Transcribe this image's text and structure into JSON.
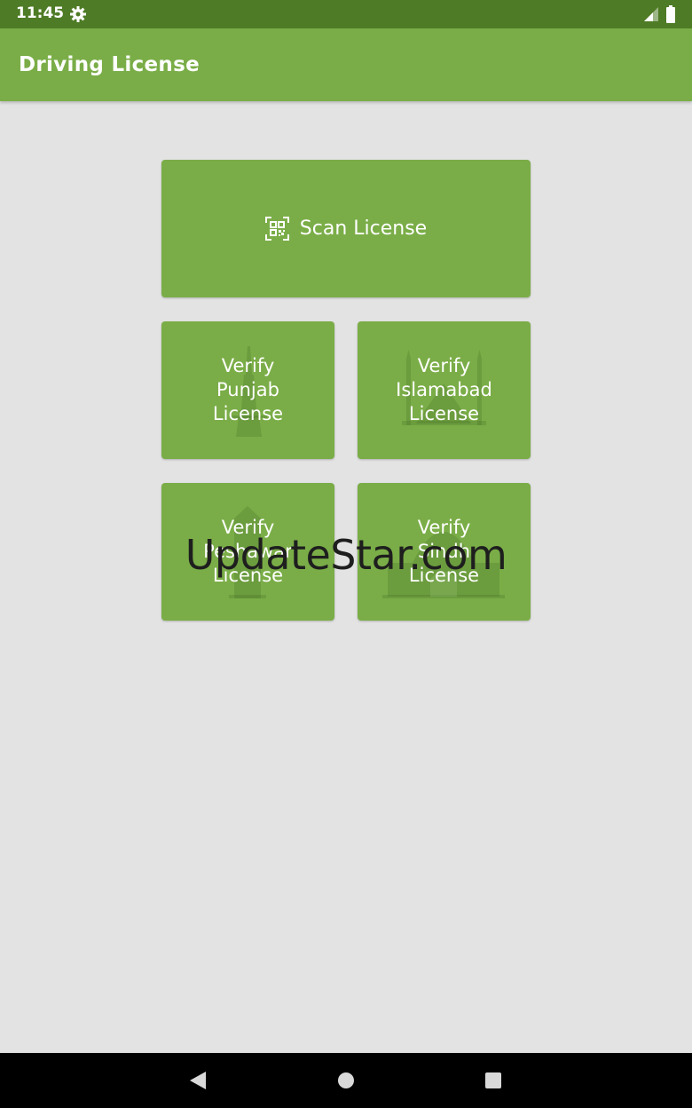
{
  "status_bar": {
    "time": "11:45",
    "icons": [
      "gear-icon",
      "signal-icon",
      "battery-icon"
    ]
  },
  "app_bar": {
    "title": "Driving License"
  },
  "tiles": {
    "scan": {
      "label": "Scan License",
      "icon": "qr-code-icon"
    },
    "punjab": {
      "label": "Verify\nPunjab\nLicense",
      "bg_icon": "minar-icon"
    },
    "islamabad": {
      "label": "Verify\nIslamabad\nLicense",
      "bg_icon": "mosque-icon"
    },
    "peshawar": {
      "label": "Verify\nPeshawar\nLicense",
      "bg_icon": "monument-icon"
    },
    "sindh": {
      "label": "Verify\nSindh\nLicense",
      "bg_icon": "mausoleum-icon"
    }
  },
  "watermark": "UpdateStar.com",
  "nav_bar": {
    "icons": [
      "back-icon",
      "home-icon",
      "recents-icon"
    ]
  },
  "colors": {
    "status_bar": "#4e7b25",
    "primary": "#7aad47",
    "background": "#e3e3e3",
    "nav_bar": "#000000"
  }
}
